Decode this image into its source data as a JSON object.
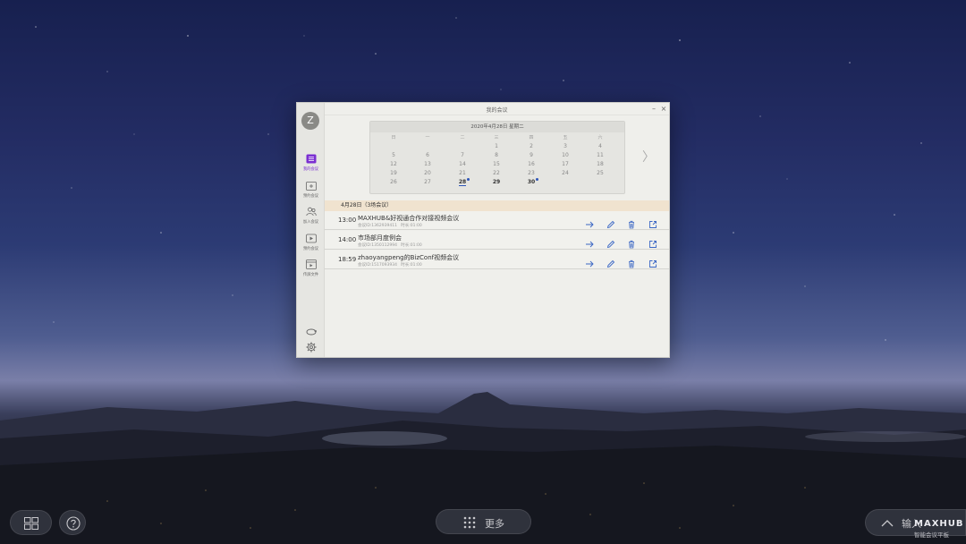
{
  "dialog": {
    "title": "我的会议",
    "avatar_letter": "Z",
    "minimize": "–",
    "close": "×"
  },
  "sidebar": {
    "items": [
      {
        "label": "我的会议",
        "icon": "list-icon",
        "active": true
      },
      {
        "label": "预约会议",
        "icon": "calendar-add-icon"
      },
      {
        "label": "加入会议",
        "icon": "join-people-icon"
      },
      {
        "label": "预约会议",
        "icon": "video-icon"
      },
      {
        "label": "传屏文件",
        "icon": "screen-share-icon"
      }
    ],
    "bottom": [
      {
        "icon": "swap-icon"
      },
      {
        "icon": "gear-icon"
      }
    ]
  },
  "calendar": {
    "header": "2020年4月28日 星期二",
    "weekdays": [
      "日",
      "一",
      "二",
      "三",
      "四",
      "五",
      "六"
    ],
    "rows": [
      [
        "",
        "",
        "",
        "1",
        "2",
        "3",
        "4"
      ],
      [
        "5",
        "6",
        "7",
        "8",
        "9",
        "10",
        "11"
      ],
      [
        "12",
        "13",
        "14",
        "15",
        "16",
        "17",
        "18"
      ],
      [
        "19",
        "20",
        "21",
        "22",
        "23",
        "24",
        "25"
      ],
      [
        "26",
        "27",
        "28",
        "29",
        "30",
        "",
        ""
      ]
    ],
    "today": "28",
    "bold_days": [
      "28",
      "29",
      "30"
    ],
    "dot_days": [
      "28",
      "30"
    ],
    "next": "〉"
  },
  "meetings": {
    "day_label": "4月28日（3场会议）",
    "items": [
      {
        "time": "13:00",
        "title": "MAXHUB&好视通合作对接视频会议",
        "id": "会议ID:1362939411",
        "duration": "时长:01:00"
      },
      {
        "time": "14:00",
        "title": "市场部月度例会",
        "id": "会议ID:1350112994",
        "duration": "时长:01:00"
      },
      {
        "time": "18:59",
        "title": "zhaoyangpeng的BizConf视频会议",
        "id": "会议ID:1517093934",
        "duration": "时长:01:00"
      }
    ]
  },
  "taskbar": {
    "more_label": "更多",
    "output_label": "输入"
  },
  "brand": {
    "name": "MAXHUB",
    "sub": "智能会议平板"
  },
  "colors": {
    "accent": "#7b2fd1",
    "action": "#3a66c4",
    "date_header_bg": "#f0e3cf"
  }
}
